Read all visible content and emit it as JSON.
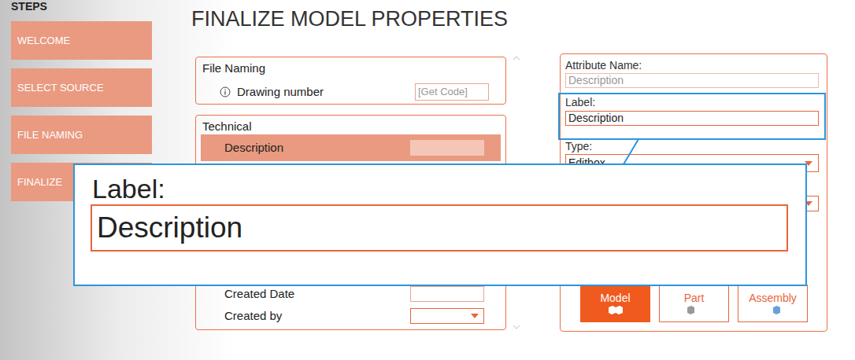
{
  "steps_header": "STEPS",
  "steps": [
    {
      "label": "WELCOME"
    },
    {
      "label": "SELECT SOURCE"
    },
    {
      "label": "FILE NAMING"
    },
    {
      "label": "FINALIZE"
    }
  ],
  "title": "FINALIZE MODEL PROPERTIES",
  "groups": [
    {
      "title": "File Naming",
      "rows": [
        {
          "label": "Drawing number",
          "info": true,
          "kind": "text",
          "placeholder": "[Get Code]",
          "selected": false
        }
      ]
    },
    {
      "title": "Technical",
      "rows": [
        {
          "label": "Description",
          "info": false,
          "kind": "text",
          "placeholder": "",
          "selected": true
        },
        {
          "label": "Created Date",
          "info": false,
          "kind": "text",
          "placeholder": "",
          "selected": false
        },
        {
          "label": "Created by",
          "info": false,
          "kind": "dropdown",
          "placeholder": "",
          "selected": false
        }
      ]
    }
  ],
  "editor": {
    "attribute_name": {
      "label": "Attribute Name:",
      "value": "Description",
      "disabled": true
    },
    "label": {
      "label": "Label:",
      "value": "Description",
      "highlighted": true
    },
    "type": {
      "label": "Type:",
      "value": "Editbox"
    },
    "second_dropdown": {
      "value": ""
    },
    "targets": [
      {
        "label": "Model",
        "selected": true
      },
      {
        "label": "Part",
        "selected": false
      },
      {
        "label": "Assembly",
        "selected": false
      }
    ]
  },
  "zoom": {
    "label": "Label:",
    "value": "Description"
  }
}
